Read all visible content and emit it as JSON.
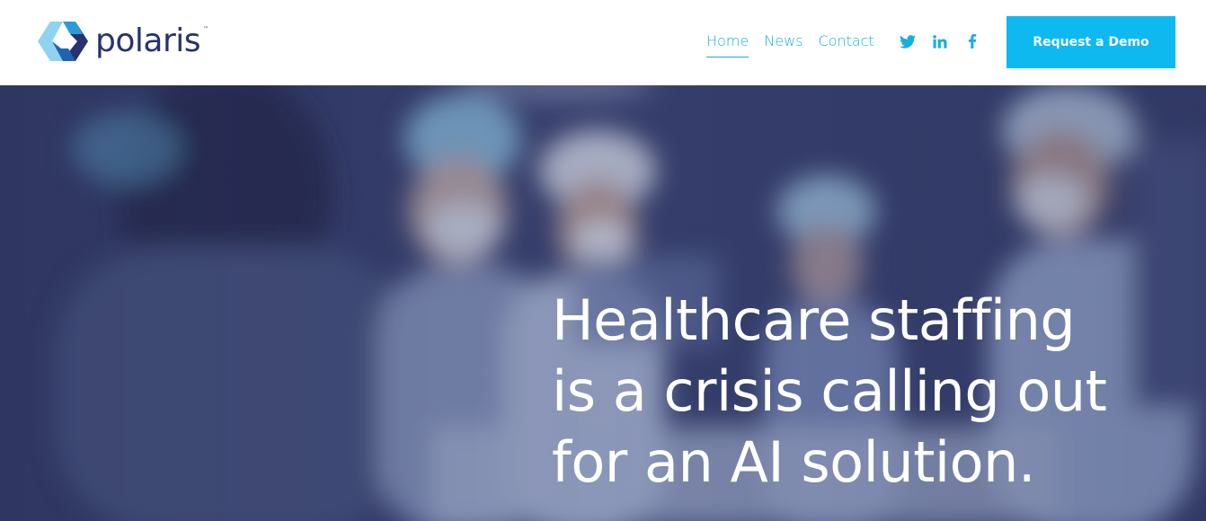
{
  "brand": {
    "name": "polaris",
    "trademark": "™",
    "logo_icon": "polaris-hexagon-logo-icon",
    "text_color": "#26336e",
    "accent_light": "#7fcdee",
    "accent_mid": "#1f8fd4",
    "accent_dark": "#26336e"
  },
  "nav": {
    "items": [
      {
        "label": "Home",
        "active": true
      },
      {
        "label": "News",
        "active": false
      },
      {
        "label": "Contact",
        "active": false
      }
    ],
    "link_color": "#17aee3"
  },
  "social": [
    {
      "icon": "twitter-icon"
    },
    {
      "icon": "linkedin-icon"
    },
    {
      "icon": "facebook-icon"
    }
  ],
  "cta": {
    "label": "Request a Demo",
    "color": "#0db9ef"
  },
  "hero": {
    "headline_lines": [
      "Healthcare staffing",
      "is a crisis calling out",
      "for an AI solution."
    ],
    "background_image": "blurred-operating-room-surgeons-photo",
    "overlay_color": "#262c56"
  }
}
